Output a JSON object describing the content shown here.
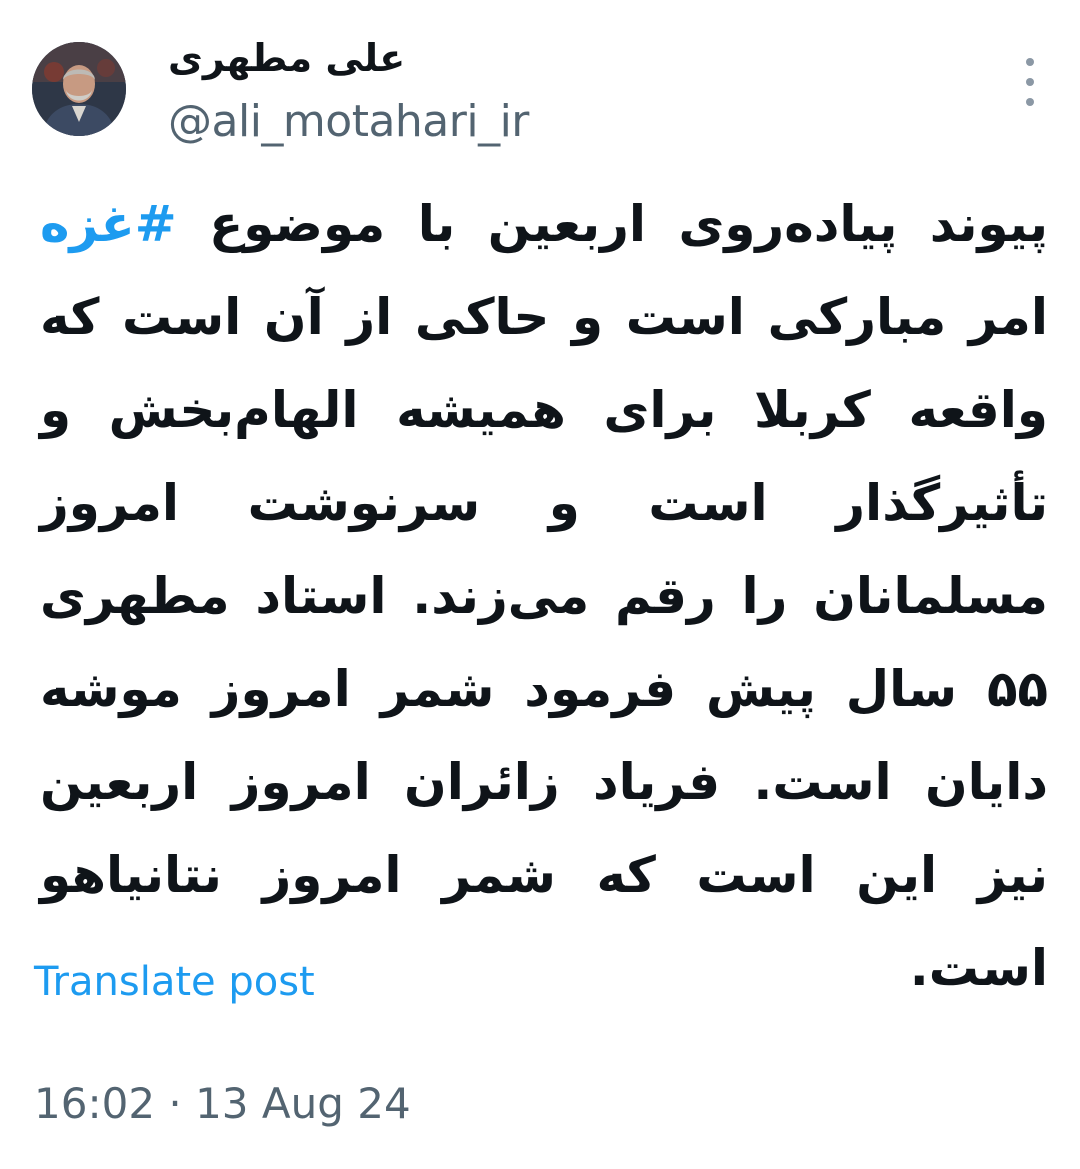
{
  "author": {
    "display_name": "علی مطهری",
    "handle": "@ali_motahari_ir",
    "avatar_icon": "user-avatar"
  },
  "more_icon": "more-dots-icon",
  "post": {
    "text_before": "پیوند پیاده‌روی اربعین با موضوع ",
    "hashtag": "#غزه",
    "text_after": " امر مبارکی است و حاکی از آن است که واقعه کربلا برای همیشه الهام‌بخش و تأثیرگذار است و سرنوشت امروز مسلمانان را رقم می‌زند. استاد مطهری ۵۵ سال پیش فرمود شمر امروز موشه دایان است. فریاد زائران امروز اربعین نیز این است که شمر امروز نتانیاهو است."
  },
  "translate_label": "Translate post",
  "timestamp": "16:02 · 13 Aug 24",
  "colors": {
    "link": "#1d9bf0",
    "text": "#0f1419",
    "secondary": "#536471"
  }
}
